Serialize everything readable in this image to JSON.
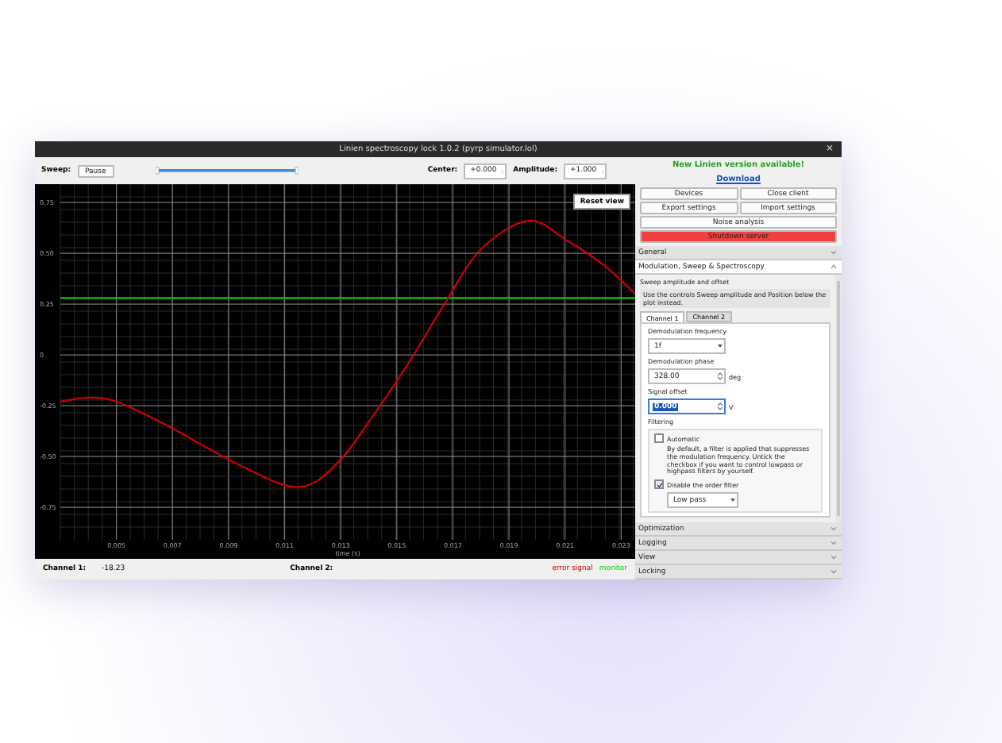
{
  "window": {
    "title": "Linien spectroscopy lock 1.0.2 (pyrp simulator.lol)",
    "close": "×"
  },
  "toolbar": {
    "sweep_label": "Sweep:",
    "pause_button": "Pause",
    "sweep_slider": {
      "level": 1
    },
    "center_label": "Center:",
    "center_value": "+0.000",
    "amplitude_label": "Amplitude:",
    "amplitude_value": "+1.000"
  },
  "plot": {
    "reset_button": "Reset view",
    "chart_data": {
      "type": "line",
      "grid": true,
      "xlabel": "time (s)",
      "x": [
        0.003,
        0.004,
        0.005,
        0.0067,
        0.0095,
        0.0115,
        0.0129,
        0.0143,
        0.0156,
        0.0167,
        0.018,
        0.0197,
        0.0211,
        0.0224,
        0.0235
      ],
      "series": [
        {
          "name": "error signal",
          "color": "#cc0000",
          "values": [
            -0.23,
            -0.21,
            -0.23,
            -0.34,
            -0.55,
            -0.65,
            -0.53,
            -0.27,
            0,
            0.25,
            0.52,
            0.66,
            0.56,
            0.44,
            0.3
          ]
        },
        {
          "name": "monitor",
          "color": "#00cc00",
          "values": [
            0.28,
            0.28,
            0.28,
            0.28,
            0.28,
            0.28,
            0.28,
            0.28,
            0.28,
            0.28,
            0.28,
            0.28,
            0.28,
            0.28,
            0.28
          ]
        }
      ],
      "xlim": [
        0.003,
        0.0235
      ],
      "ylim": [
        -0.91,
        0.84
      ],
      "xticks": [
        {
          "value": 0.005,
          "label": "0.005"
        },
        {
          "value": 0.007,
          "label": "0.007"
        },
        {
          "value": 0.009,
          "label": "0.009"
        },
        {
          "value": 0.011,
          "label": "0.011"
        },
        {
          "value": 0.013,
          "label": "0.013"
        },
        {
          "value": 0.015,
          "label": "0.015"
        },
        {
          "value": 0.017,
          "label": "0.017"
        },
        {
          "value": 0.019,
          "label": "0.019"
        },
        {
          "value": 0.021,
          "label": "0.021"
        },
        {
          "value": 0.023,
          "label": "0.023"
        }
      ],
      "yticks": [
        {
          "value": 0.75,
          "label": "0.75"
        },
        {
          "value": 0.5,
          "label": "0.50"
        },
        {
          "value": 0.25,
          "label": "0.25"
        },
        0,
        {
          "value": -0.25,
          "label": "-0.25"
        },
        {
          "value": -0.5,
          "label": "-0.50"
        },
        {
          "value": -0.75,
          "label": "-0.75"
        }
      ]
    }
  },
  "status": {
    "channel1_label": "Channel 1:",
    "channel1_value": "-18.23",
    "channel2_label": "Channel 2:"
  },
  "panel": {
    "notice": "New Linien version available!",
    "download_link": "Download",
    "buttons": [
      {
        "label": "Devices",
        "kind": "half"
      },
      {
        "label": "Close client",
        "kind": "half"
      },
      {
        "label": "Export settings",
        "kind": "half"
      },
      {
        "label": "Import settings",
        "kind": "half"
      },
      {
        "label": "Noise analysis",
        "kind": "full"
      },
      {
        "label": "Shutdown server",
        "kind": "danger"
      }
    ],
    "sections_before": [
      {
        "title": "General",
        "expanded": false
      },
      {
        "title": "Modulation, Sweep & Spectroscopy",
        "expanded": true
      }
    ],
    "group_title": "Sweep amplitude and offset",
    "group_info": "Use the controls Sweep amplitude and Position below the plot instead.",
    "channel_tabs": [
      {
        "label": "Channel 1",
        "selected": true
      },
      {
        "label": "Channel 2",
        "selected": false
      }
    ],
    "demod_freq": {
      "label": "Demodulation frequency",
      "value": "1f"
    },
    "demod_phase": {
      "label": "Demodulation phase",
      "value": "328.00",
      "unit": "deg"
    },
    "signal_offset": {
      "label": "Signal offset",
      "value": "0.000",
      "unit": "V",
      "focused": true
    },
    "filtering": {
      "title": "Filtering",
      "automatic": {
        "label": "Automatic",
        "checked": false
      },
      "description": "By default, a filter is applied that suppresses the modulation frequency. Untick the checkbox if you want to control lowpass or highpass filters by yourself.",
      "disable": {
        "label": "Disable the order filter",
        "checked": true
      },
      "filter_type": "Low pass"
    },
    "sections_after": [
      {
        "title": "Optimization",
        "expanded": false
      },
      {
        "title": "Logging",
        "expanded": false
      },
      {
        "title": "View",
        "expanded": false
      },
      {
        "title": "Locking",
        "expanded": false
      }
    ]
  }
}
